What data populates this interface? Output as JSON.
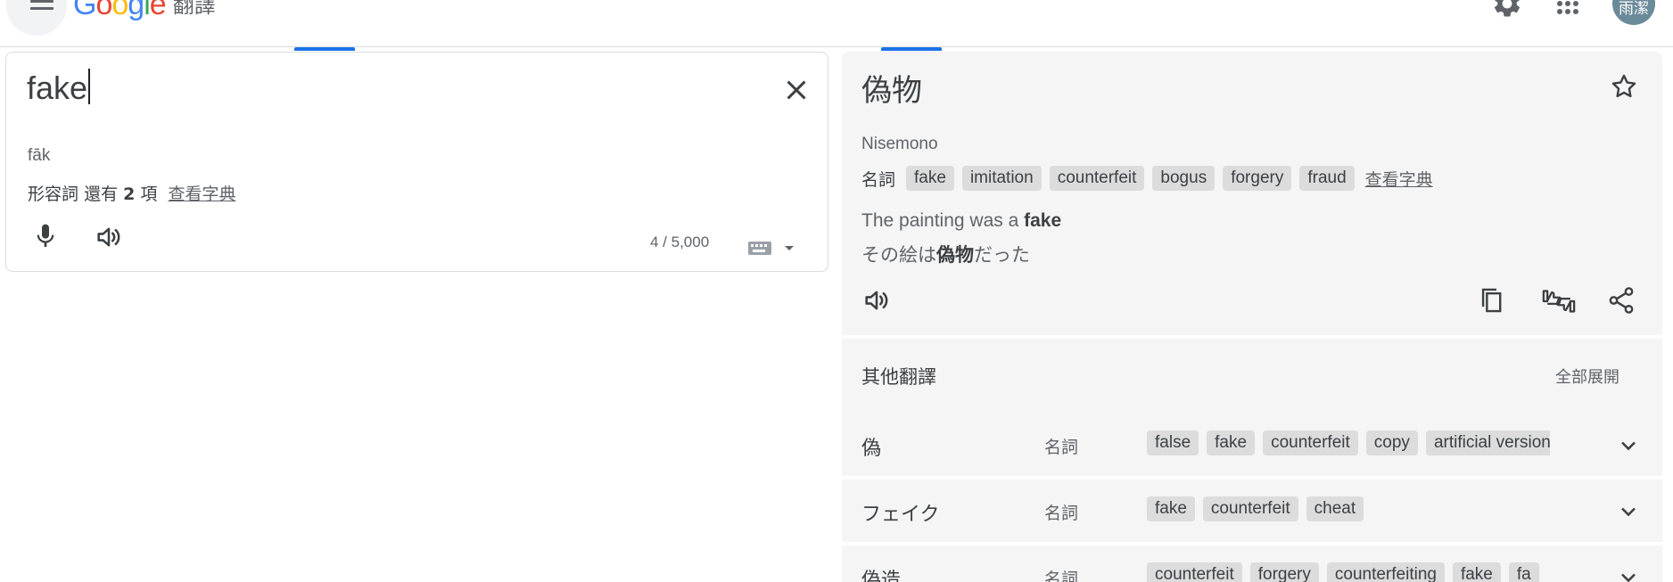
{
  "header": {
    "logo_brand": "Google",
    "logo_product": "翻譯",
    "avatar_text": "雨潔",
    "icons": [
      "menu-icon",
      "settings-icon",
      "apps-icon"
    ]
  },
  "source": {
    "text": "fake",
    "transliteration": "fāk",
    "pos": "形容詞",
    "more_prefix": "還有",
    "more_count": "2",
    "more_suffix": "項",
    "dictionary_link": "查看字典",
    "char_count": "4 / 5,000"
  },
  "target": {
    "text": "偽物",
    "romanization": "Nisemono",
    "pos": "名詞",
    "chips": [
      "fake",
      "imitation",
      "counterfeit",
      "bogus",
      "forgery",
      "fraud"
    ],
    "dictionary_link": "查看字典",
    "example_en_prefix": "The painting was a ",
    "example_en_bold": "fake",
    "example_ja_prefix": "その絵は",
    "example_ja_bold": "偽物",
    "example_ja_suffix": "だった"
  },
  "other_translations": {
    "title": "其他翻譯",
    "expand_all": "全部展開",
    "rows": [
      {
        "word": "偽",
        "pos": "名詞",
        "chips": [
          "false",
          "fake",
          "counterfeit",
          "copy",
          "artificial version"
        ]
      },
      {
        "word": "フェイク",
        "pos": "名詞",
        "chips": [
          "fake",
          "counterfeit",
          "cheat"
        ]
      },
      {
        "word": "偽造",
        "pos": "名詞",
        "chips": [
          "counterfeit",
          "forgery",
          "counterfeiting",
          "fake",
          "fa"
        ]
      }
    ]
  },
  "colors": {
    "google_blue": "#4285f4",
    "google_red": "#ea4335",
    "google_yellow": "#fbbc05",
    "google_green": "#34a853",
    "accent": "#1a73e8",
    "panel_bg": "#f5f5f5",
    "chip_bg": "#dcdcdc"
  }
}
